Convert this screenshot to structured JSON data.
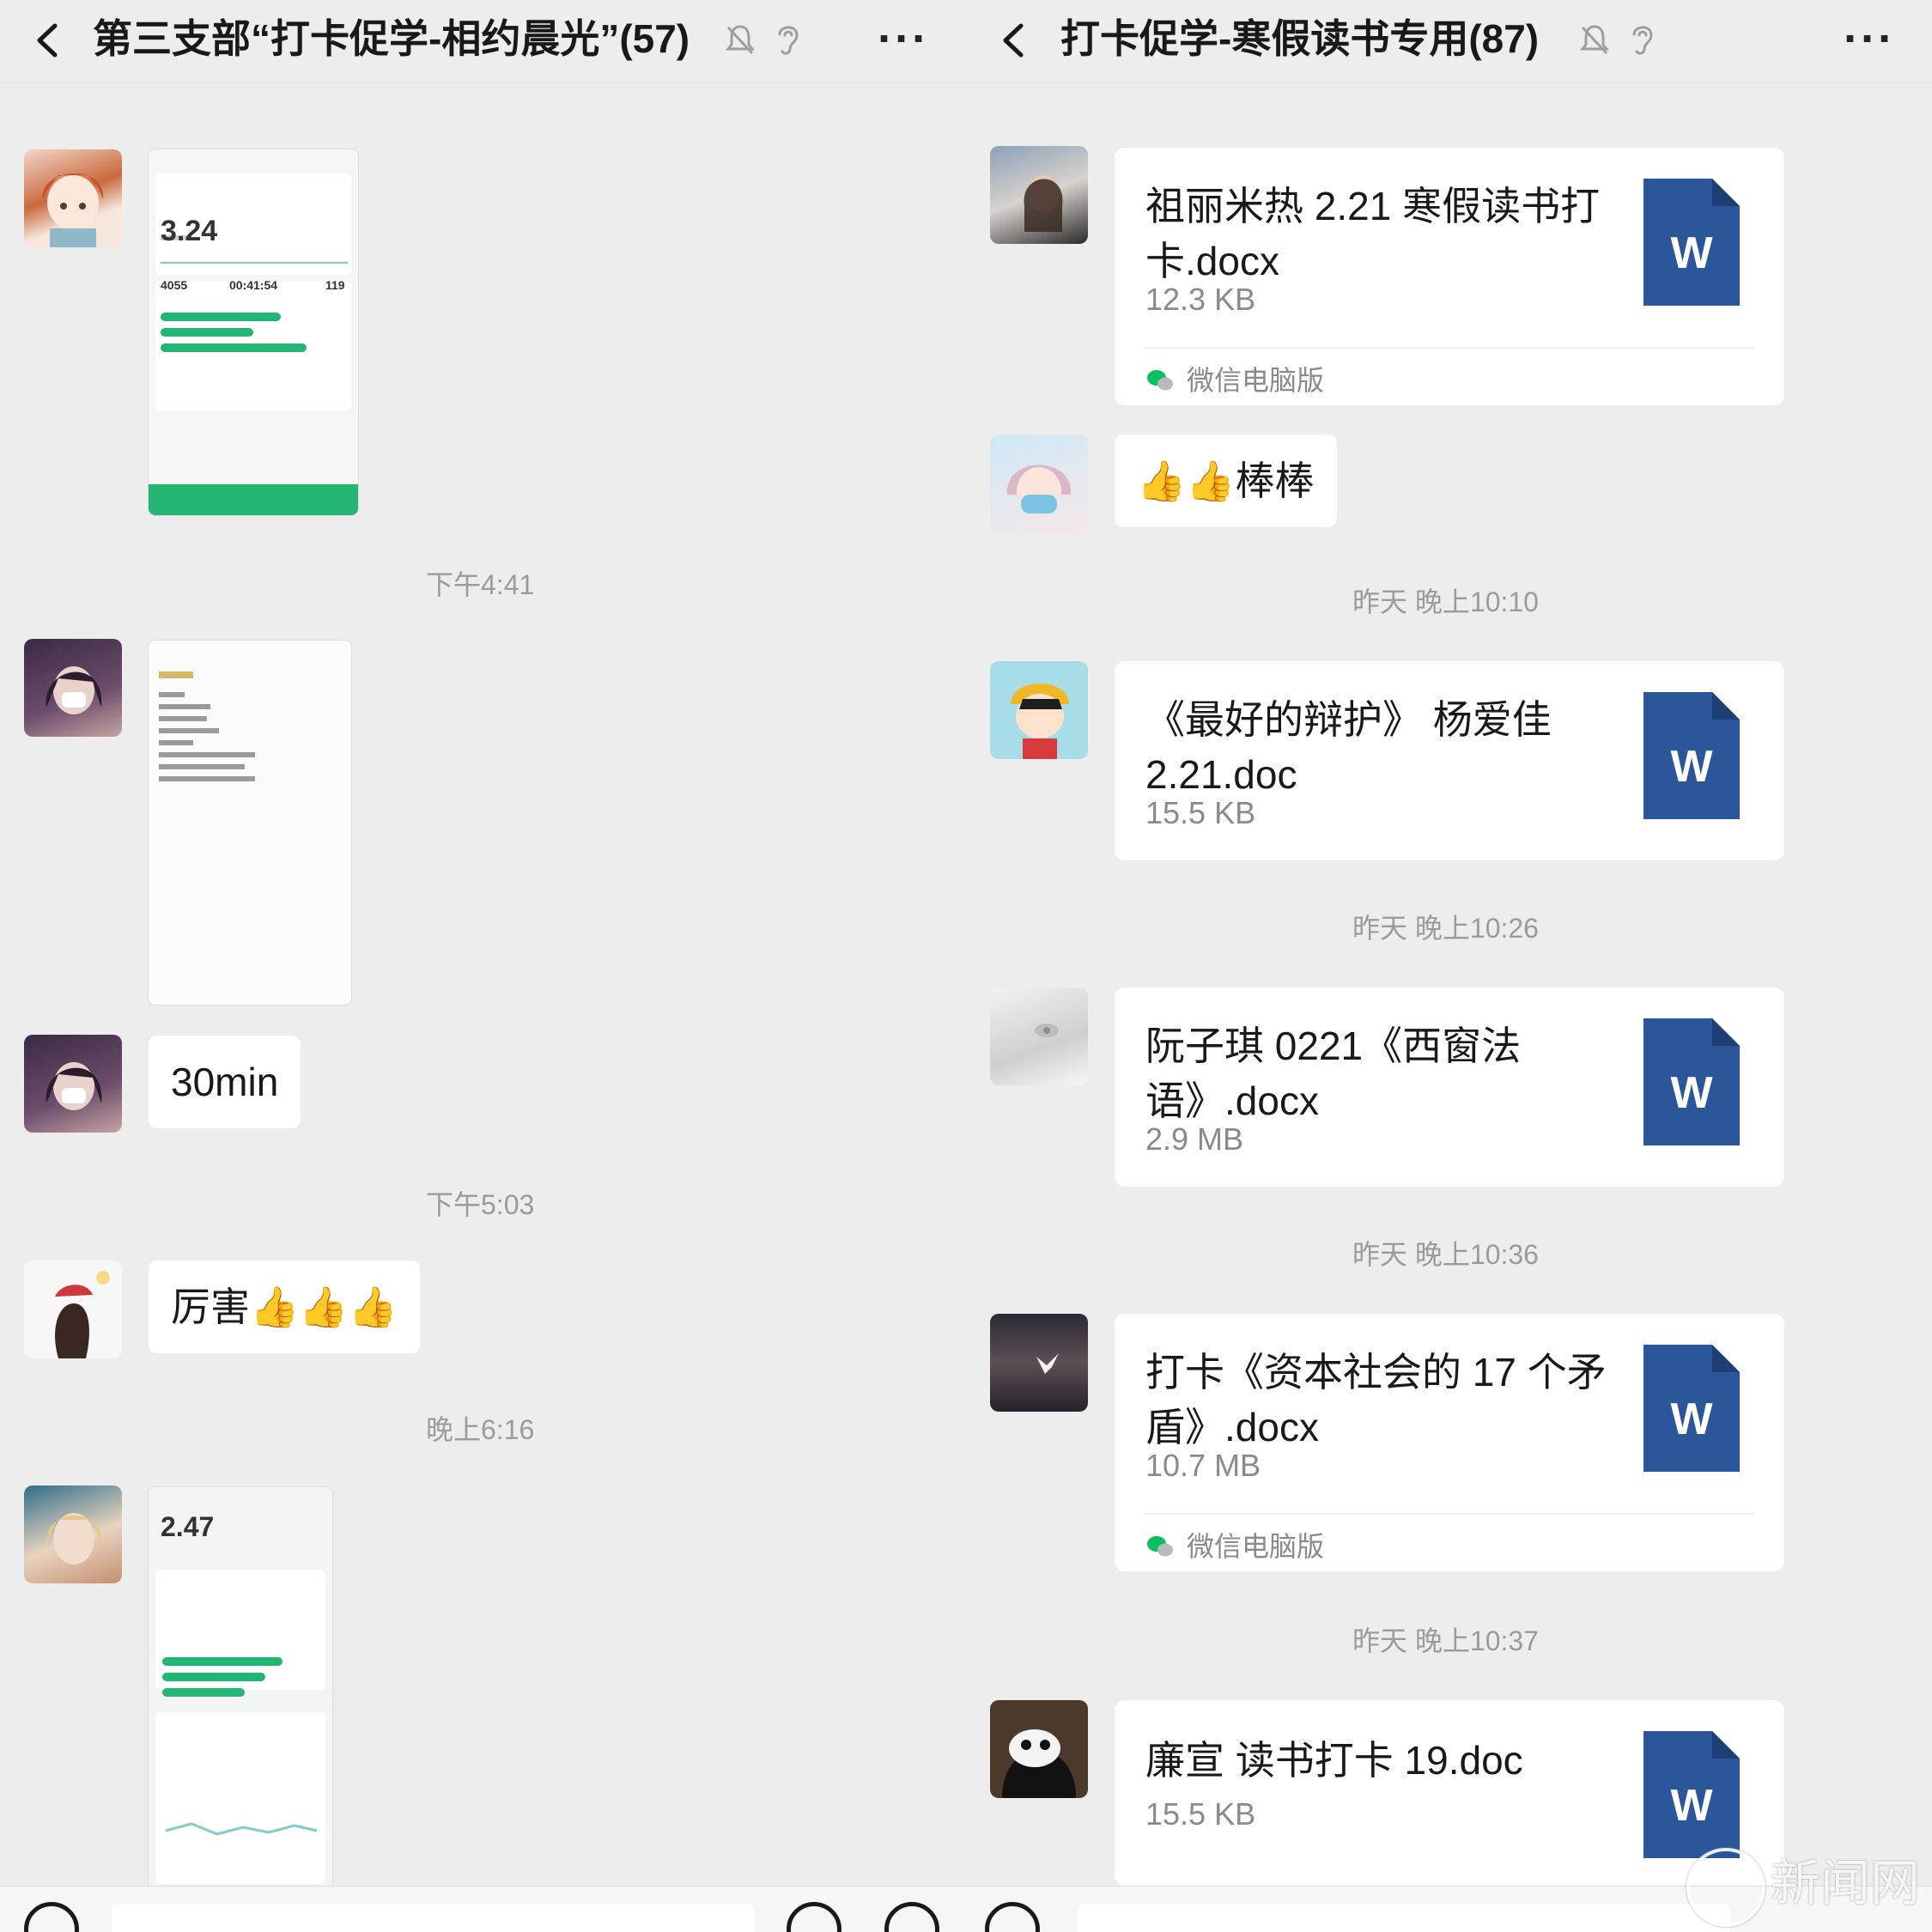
{
  "left": {
    "title": "第三支部“打卡促学-相约晨光”(57)",
    "times": [
      "下午4:41",
      "下午5:03",
      "晚上6:16"
    ],
    "messages": {
      "text1": "30min",
      "text2": "厉害👍👍👍"
    },
    "screenshot1": {
      "distance": "3.24",
      "stats": [
        "4055",
        "00:41:54",
        "119"
      ]
    },
    "screenshot3": {
      "distance": "2.47"
    }
  },
  "right": {
    "title": "打卡促学-寒假读书专用(87)",
    "reaction": "👍👍棒棒",
    "times": [
      "昨天 晚上10:10",
      "昨天 晚上10:26",
      "昨天 晚上10:36",
      "昨天 晚上10:37"
    ],
    "files": [
      {
        "name": "祖丽米热 2.21 寒假读书打卡.docx",
        "size": "12.3 KB",
        "source": "微信电脑版"
      },
      {
        "name": "《最好的辩护》 杨爱佳 2.21.doc",
        "size": "15.5 KB"
      },
      {
        "name": "阮子琪 0221《西窗法语》.docx",
        "size": "2.9 MB"
      },
      {
        "name": "打卡《资本社会的 17 个矛盾》.docx",
        "size": "10.7 MB",
        "source": "微信电脑版"
      },
      {
        "name": "廉宣 读书打卡 19.doc",
        "size": "15.5 KB"
      }
    ]
  },
  "icons": {
    "back": "chevron-left-icon",
    "mute": "bell-off-icon",
    "ear": "ear-icon",
    "more": "more-dots-icon",
    "word": "word-document-icon",
    "wechat": "wechat-icon"
  },
  "colors": {
    "background": "#ededed",
    "bubble": "#ffffff",
    "word_blue": "#2b579a",
    "keep_green": "#22b573",
    "wechat_green": "#07c160"
  },
  "watermark": "新闻网"
}
